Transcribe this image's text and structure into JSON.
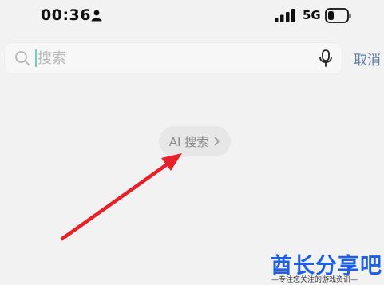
{
  "status_bar": {
    "time": "00:36",
    "network_type": "5G",
    "icons": [
      "person-icon",
      "signal-icon",
      "battery-icon"
    ]
  },
  "search": {
    "placeholder": "搜索",
    "value": "",
    "cancel_label": "取消",
    "icons": [
      "search-icon",
      "mic-icon"
    ]
  },
  "ai_search": {
    "label": "AI 搜索",
    "icon": "chevron-right-icon"
  },
  "annotation": {
    "color": "#e8202a"
  },
  "watermark": {
    "title": "酋长分享吧",
    "subtitle": "—专注您关注的游戏资讯—",
    "color": "#1d5fe6"
  }
}
